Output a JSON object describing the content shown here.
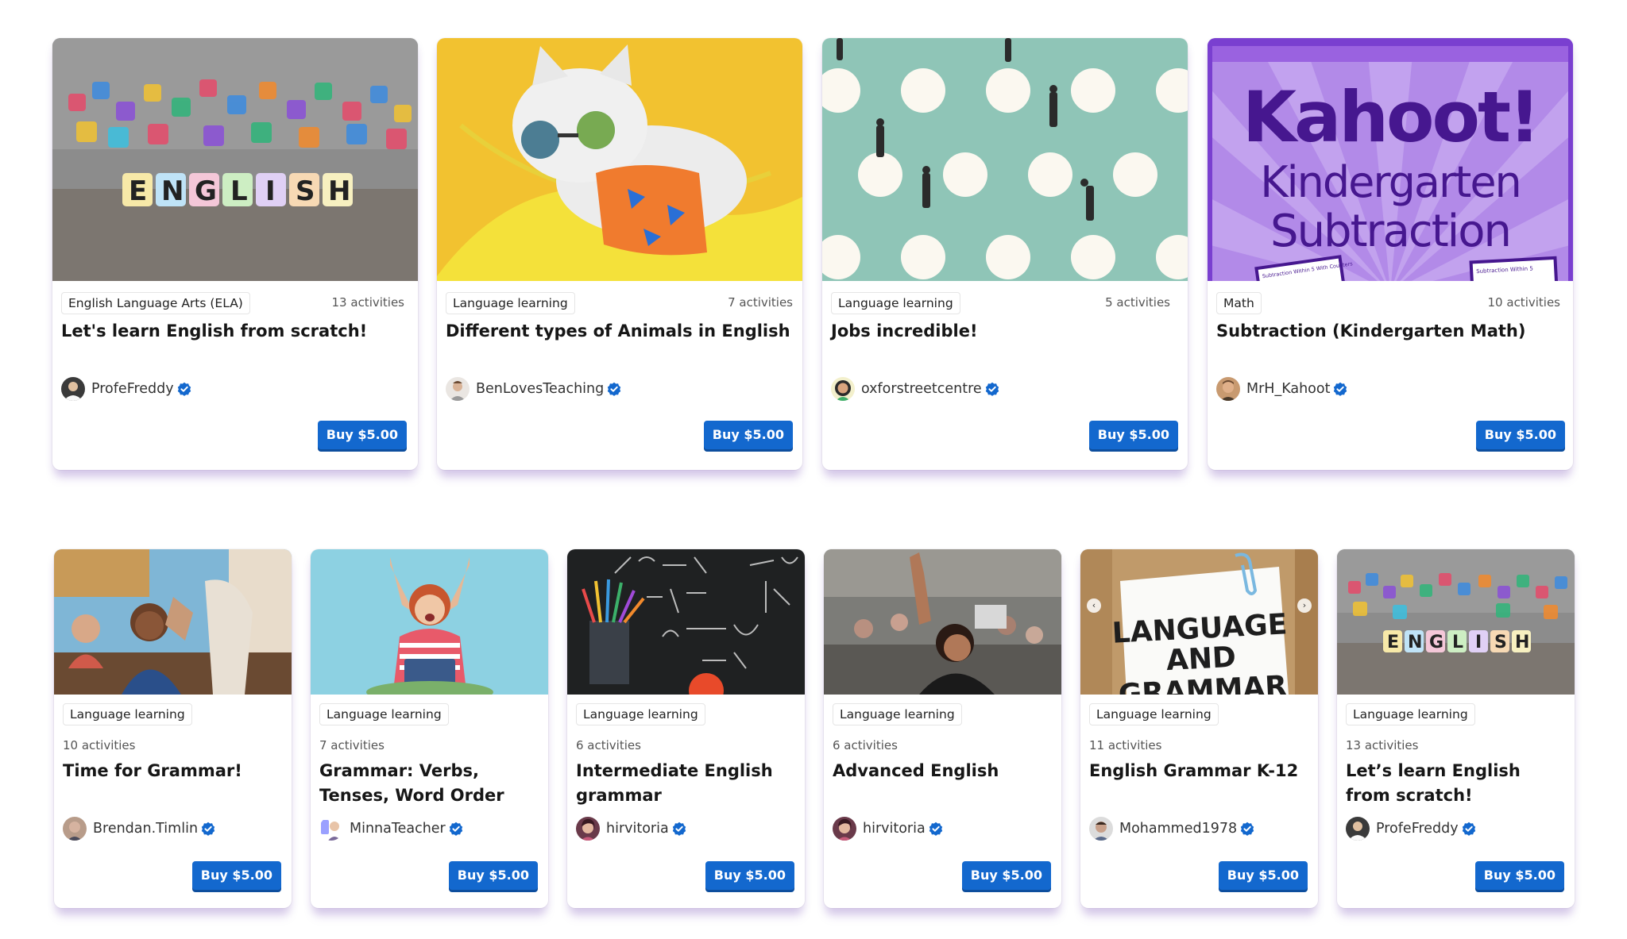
{
  "row1": [
    {
      "category": "English Language Arts (ELA)",
      "activities": "13 activities",
      "title": "Let's learn English from scratch!",
      "author": "ProfeFreddy",
      "buy_label": "Buy $5.00",
      "thumb": "english-blocks"
    },
    {
      "category": "Language learning",
      "activities": "7 activities",
      "title": "Different types of Animals in English",
      "author": "BenLovesTeaching",
      "buy_label": "Buy $5.00",
      "thumb": "cat-hammock"
    },
    {
      "category": "Language learning",
      "activities": "5 activities",
      "title": "Jobs incredible!",
      "author": "oxforstreetcentre",
      "buy_label": "Buy $5.00",
      "thumb": "polka-dots-people"
    },
    {
      "category": "Math",
      "activities": "10 activities",
      "title": "Subtraction (Kindergarten Math)",
      "author": "MrH_Kahoot",
      "buy_label": "Buy $5.00",
      "thumb": "kahoot-subtraction",
      "thumb_text": {
        "line1": "Kahoot!",
        "line2": "Kindergarten",
        "line3": "Subtraction",
        "tag1": "Subtraction Within 5 With Counters",
        "tag2": "Subtraction Within 5"
      }
    }
  ],
  "row2": [
    {
      "category": "Language learning",
      "activities": "10 activities",
      "title": "Time for Grammar!",
      "author": "Brendan.Timlin",
      "buy_label": "Buy $5.00",
      "thumb": "classroom-high-five"
    },
    {
      "category": "Language learning",
      "activities": "7 activities",
      "title": "Grammar: Verbs, Tenses, Word Order",
      "author": "MinnaTeacher",
      "buy_label": "Buy $5.00",
      "thumb": "celebrating-student"
    },
    {
      "category": "Language learning",
      "activities": "6 activities",
      "title": "Intermediate English grammar",
      "author": "hirvitoria",
      "buy_label": "Buy $5.00",
      "thumb": "chalkboard-math"
    },
    {
      "category": "Language learning",
      "activities": "6 activities",
      "title": "Advanced English",
      "author": "hirvitoria",
      "buy_label": "Buy $5.00",
      "thumb": "raised-hand-class"
    },
    {
      "category": "Language learning",
      "activities": "11 activities",
      "title": "English Grammar K-12",
      "author": "Mohammed1978",
      "buy_label": "Buy $5.00",
      "thumb": "language-grammar-note",
      "thumb_text": {
        "line1": "LANGUAGE",
        "line2": "AND",
        "line3": "GRAMMAR"
      }
    },
    {
      "category": "Language learning",
      "activities": "13 activities",
      "title": "Let’s learn English from scratch!",
      "author": "ProfeFreddy",
      "buy_label": "Buy $5.00",
      "thumb": "english-blocks"
    }
  ],
  "colors": {
    "buy_button": "#1368ce",
    "verified_badge": "#1368ce",
    "kahoot_purple": "#46178f"
  },
  "icons": [
    "verified-badge-icon",
    "chevron-left-icon",
    "chevron-right-icon"
  ]
}
